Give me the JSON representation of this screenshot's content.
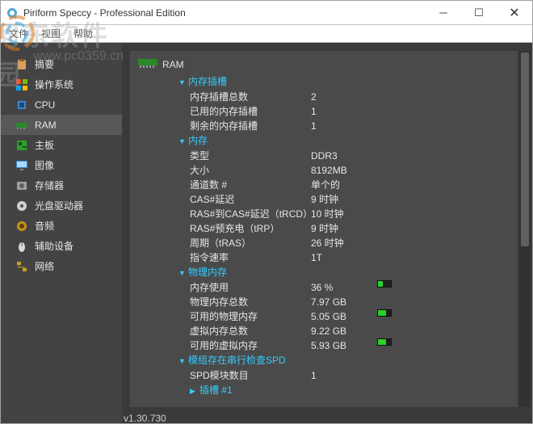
{
  "window": {
    "title": "Piriform Speccy - Professional Edition"
  },
  "menu": {
    "items": [
      "文件",
      "视图",
      "帮助"
    ]
  },
  "watermark": {
    "main": "河东软件园",
    "sub": "www.pc0359.cn"
  },
  "sidebar": {
    "items": [
      {
        "label": "摘要"
      },
      {
        "label": "操作系统"
      },
      {
        "label": "CPU"
      },
      {
        "label": "RAM"
      },
      {
        "label": "主板"
      },
      {
        "label": "图像"
      },
      {
        "label": "存储器"
      },
      {
        "label": "光盘驱动器"
      },
      {
        "label": "音频"
      },
      {
        "label": "辅助设备"
      },
      {
        "label": "网络"
      }
    ],
    "selected_index": 3
  },
  "content": {
    "header": "RAM",
    "groups": [
      {
        "title": "内存插槽",
        "rows": [
          {
            "k": "内存插槽总数",
            "v": "2"
          },
          {
            "k": "已用的内存插槽",
            "v": "1"
          },
          {
            "k": "剩余的内存插槽",
            "v": "1"
          }
        ]
      },
      {
        "title": "内存",
        "rows": [
          {
            "k": "类型",
            "v": "DDR3"
          },
          {
            "k": "大小",
            "v": "8192MB"
          },
          {
            "k": "通道数 #",
            "v": "单个的"
          },
          {
            "k": "CAS#延迟",
            "v": "9 时钟"
          },
          {
            "k": "RAS#到CAS#延迟（tRCD）",
            "v": "10 时钟"
          },
          {
            "k": "RAS#预充电（tRP）",
            "v": "9 时钟"
          },
          {
            "k": "周期（tRAS）",
            "v": "26 时钟"
          },
          {
            "k": "指令速率",
            "v": "1T"
          }
        ]
      },
      {
        "title": "物理内存",
        "rows": [
          {
            "k": "内存使用",
            "v": "36 %",
            "bar": 36
          },
          {
            "k": "物理内存总数",
            "v": "7.97 GB"
          },
          {
            "k": "可用的物理内存",
            "v": "5.05 GB",
            "bar": 63
          },
          {
            "k": "虚拟内存总数",
            "v": "9.22 GB"
          },
          {
            "k": "可用的虚拟内存",
            "v": "5.93 GB",
            "bar": 64
          }
        ]
      },
      {
        "title": "模组存在串行检查SPD",
        "rows": [
          {
            "k": "SPD模块数目",
            "v": "1"
          }
        ],
        "sub": {
          "title": "插槽 #1"
        }
      }
    ]
  },
  "footer": {
    "version": "v1.30.730"
  }
}
